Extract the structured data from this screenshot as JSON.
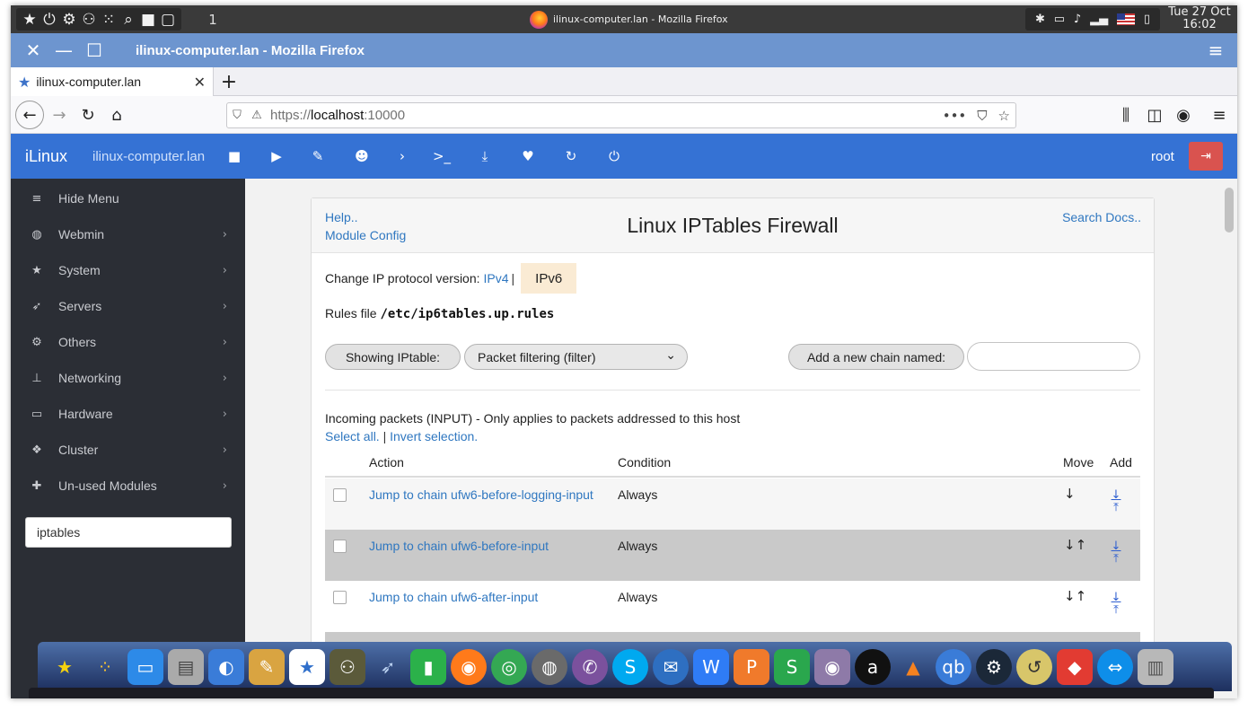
{
  "system_panel": {
    "workspace_number": "1",
    "window_title": "ilinux-computer.lan - Mozilla Firefox",
    "clock_line1": "Tue 27 Oct",
    "clock_line2": "16:02"
  },
  "window": {
    "title": "ilinux-computer.lan - Mozilla Firefox"
  },
  "browser": {
    "tab_label": "ilinux-computer.lan",
    "url_scheme": "https://",
    "url_host": "localhost",
    "url_port": ":10000"
  },
  "webmin_header": {
    "brand": "iLinux",
    "host": "ilinux-computer.lan",
    "user": "root"
  },
  "sidebar": {
    "items": [
      {
        "label": "Hide Menu",
        "icon": "bars-icon"
      },
      {
        "label": "Webmin",
        "icon": "globe-icon"
      },
      {
        "label": "System",
        "icon": "star-icon"
      },
      {
        "label": "Servers",
        "icon": "rocket-icon"
      },
      {
        "label": "Others",
        "icon": "cogs-icon"
      },
      {
        "label": "Networking",
        "icon": "sitemap-icon"
      },
      {
        "label": "Hardware",
        "icon": "hdd-icon"
      },
      {
        "label": "Cluster",
        "icon": "cubes-icon"
      },
      {
        "label": "Un-used Modules",
        "icon": "puzzle-icon"
      }
    ],
    "search_value": "iptables"
  },
  "page": {
    "help_link": "Help..",
    "module_config_link": "Module Config",
    "title": "Linux IPTables Firewall",
    "search_docs_link": "Search Docs..",
    "protocol_label": "Change IP protocol version:",
    "protocol_ipv4": "IPv4",
    "protocol_separator": "|",
    "protocol_active": "IPv6",
    "rules_label": "Rules file",
    "rules_path": "/etc/ip6tables.up.rules",
    "showing_button": "Showing IPtable:",
    "table_select_value": "Packet filtering (filter)",
    "add_chain_button": "Add a new chain named:",
    "add_chain_value": "",
    "section_description": "Incoming packets (INPUT) - Only applies to packets addressed to this host",
    "select_all": "Select all.",
    "selection_separator": "|",
    "invert_selection": "Invert selection.",
    "columns": [
      "Action",
      "Condition",
      "Move",
      "Add"
    ],
    "rows": [
      {
        "action": "Jump to chain ufw6-before-logging-input",
        "condition": "Always",
        "move": "↓"
      },
      {
        "action": "Jump to chain ufw6-before-input",
        "condition": "Always",
        "move": "↓↑"
      },
      {
        "action": "Jump to chain ufw6-after-input",
        "condition": "Always",
        "move": "↓↑"
      }
    ]
  },
  "colors": {
    "webmin_blue": "#3572d4",
    "titlebar_blue": "#6d95cf",
    "sidebar_dark": "#2b2e35",
    "link_blue": "#2f77c0",
    "logout_red": "#d9534f",
    "ipv6_highlight": "#faebd4"
  },
  "dock_icons": [
    "star-icon",
    "apps-icon",
    "desktop-icon",
    "file-cabinet-icon",
    "settings-toggle-icon",
    "palette-icon",
    "bookmark-icon",
    "binoculars-icon",
    "rocket-icon",
    "pipe-icon",
    "firefox-icon",
    "chrome-icon",
    "earth-pro-icon",
    "viber-icon",
    "skype-icon",
    "mail-icon",
    "wps-writer-icon",
    "wps-presentation-icon",
    "wps-spreadsheet-icon",
    "webcam-icon",
    "anydesk-icon",
    "vlc-icon",
    "qbittorrent-icon",
    "steam-icon",
    "backup-icon",
    "anydesk-red-icon",
    "teamviewer-icon",
    "trash-icon"
  ]
}
